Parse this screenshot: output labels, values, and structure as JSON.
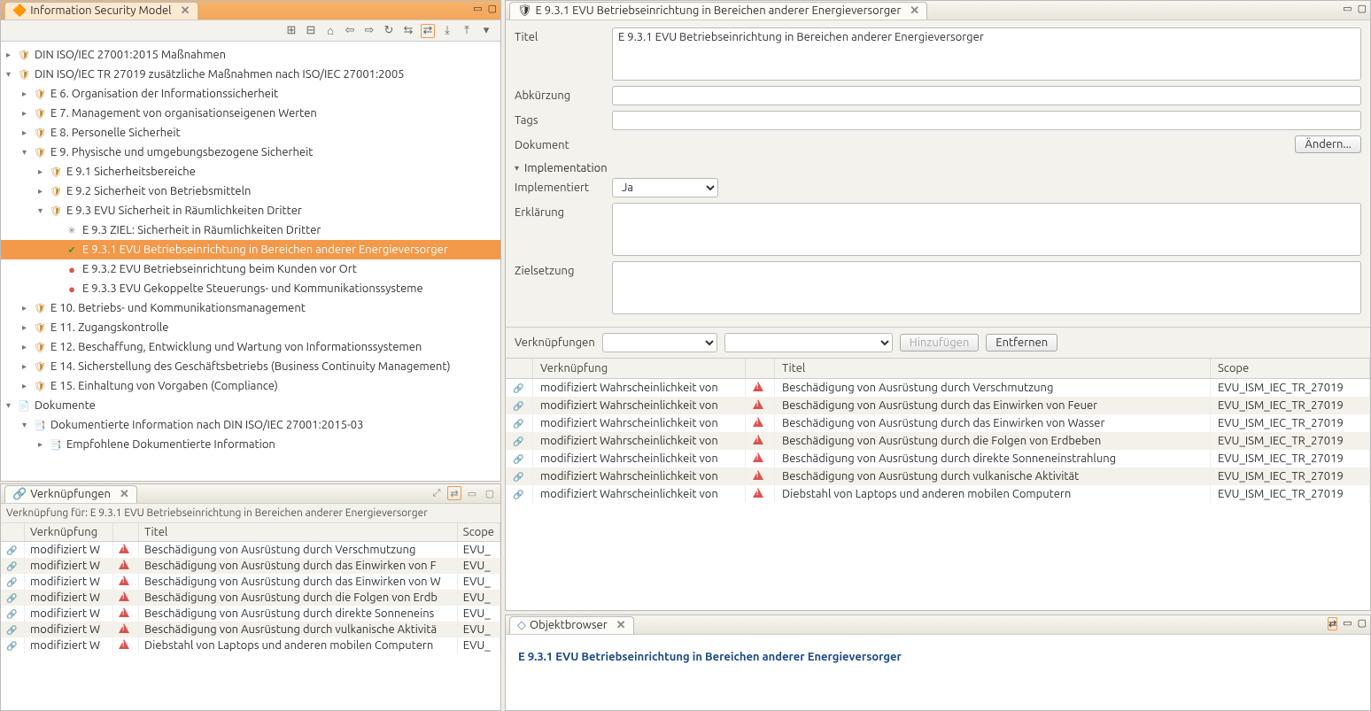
{
  "accent": "#f2994a",
  "left_pane": {
    "title": "Information Security Model",
    "toolbar_icons": [
      "expand",
      "collapse",
      "home",
      "back",
      "fwd",
      "refresh",
      "link-sel",
      "link-all",
      "import",
      "export",
      "filter"
    ],
    "tree": [
      {
        "d": 0,
        "tw": "▸",
        "ic": "shield",
        "label": "DIN ISO/IEC 27001:2015 Maßnahmen"
      },
      {
        "d": 0,
        "tw": "▾",
        "ic": "shield",
        "label": "DIN ISO/IEC TR 27019 zusätzliche Maßnahmen nach ISO/IEC 27001:2005"
      },
      {
        "d": 1,
        "tw": "▸",
        "ic": "shield",
        "label": "E 6. Organisation der Informationssicherheit"
      },
      {
        "d": 1,
        "tw": "▸",
        "ic": "shield",
        "label": "E 7. Management von organisationseigenen Werten"
      },
      {
        "d": 1,
        "tw": "▸",
        "ic": "shield",
        "label": "E 8. Personelle Sicherheit"
      },
      {
        "d": 1,
        "tw": "▾",
        "ic": "shield",
        "label": "E 9. Physische und umgebungsbezogene Sicherheit"
      },
      {
        "d": 2,
        "tw": "▸",
        "ic": "shield",
        "label": "E 9.1 Sicherheitsbereiche"
      },
      {
        "d": 2,
        "tw": "▸",
        "ic": "shield",
        "label": "E 9.2 Sicherheit von Betriebsmitteln"
      },
      {
        "d": 2,
        "tw": "▾",
        "ic": "shield",
        "label": "E 9.3 EVU Sicherheit in Räumlichkeiten Dritter"
      },
      {
        "d": 3,
        "tw": "",
        "ic": "target",
        "label": "E 9.3 ZIEL: Sicherheit in Räumlichkeiten Dritter"
      },
      {
        "d": 3,
        "tw": "",
        "ic": "ok",
        "label": "E 9.3.1 EVU Betriebseinrichtung in Bereichen anderer Energieversorger",
        "sel": true
      },
      {
        "d": 3,
        "tw": "",
        "ic": "warn",
        "label": "E 9.3.2 EVU Betriebseinrichtung beim Kunden vor Ort"
      },
      {
        "d": 3,
        "tw": "",
        "ic": "warn",
        "label": "E 9.3.3 EVU Gekoppelte Steuerungs- und Kommunikationssysteme"
      },
      {
        "d": 1,
        "tw": "▸",
        "ic": "shield",
        "label": "E 10. Betriebs- und Kommunikationsmanagement"
      },
      {
        "d": 1,
        "tw": "▸",
        "ic": "shield",
        "label": "E 11. Zugangskontrolle"
      },
      {
        "d": 1,
        "tw": "▸",
        "ic": "shield",
        "label": "E 12. Beschaffung, Entwicklung und Wartung von Informationssystemen"
      },
      {
        "d": 1,
        "tw": "▸",
        "ic": "shield",
        "label": "E 14. Sicherstellung des Geschäftsbetriebs (Business Continuity Management)"
      },
      {
        "d": 1,
        "tw": "▸",
        "ic": "shield",
        "label": "E 15. Einhaltung von Vorgaben (Compliance)"
      },
      {
        "d": 0,
        "tw": "▾",
        "ic": "folder",
        "label": "Dokumente"
      },
      {
        "d": 1,
        "tw": "▾",
        "ic": "doc",
        "label": "Dokumentierte Information nach DIN ISO/IEC 27001:2015-03"
      },
      {
        "d": 2,
        "tw": "▸",
        "ic": "doc",
        "label": "Empfohlene Dokumentierte Information"
      }
    ]
  },
  "links_small": {
    "title": "Verknüpfungen",
    "sub_label": "Verknüpfung für: E 9.3.1 EVU Betriebseinrichtung in Bereichen anderer Energieversorger",
    "columns": [
      "Verknüpfung",
      "",
      "Titel",
      "Scope"
    ],
    "rows": [
      {
        "v": "modifiziert W",
        "t": "Beschädigung von Ausrüstung durch Verschmutzung",
        "s": "EVU_"
      },
      {
        "v": "modifiziert W",
        "t": "Beschädigung von Ausrüstung durch das Einwirken von F",
        "s": "EVU_"
      },
      {
        "v": "modifiziert W",
        "t": "Beschädigung von Ausrüstung durch das Einwirken von W",
        "s": "EVU_"
      },
      {
        "v": "modifiziert W",
        "t": "Beschädigung von Ausrüstung durch die Folgen von Erdb",
        "s": "EVU_"
      },
      {
        "v": "modifiziert W",
        "t": "Beschädigung von Ausrüstung durch direkte Sonneneins",
        "s": "EVU_"
      },
      {
        "v": "modifiziert W",
        "t": "Beschädigung von Ausrüstung durch vulkanische Aktivitä",
        "s": "EVU_"
      },
      {
        "v": "modifiziert W",
        "t": "Diebstahl von Laptops und anderen mobilen Computern",
        "s": "EVU_"
      }
    ]
  },
  "detail": {
    "tab_title": "E 9.3.1 EVU Betriebseinrichtung in Bereichen anderer Energieversorger",
    "fields": {
      "titel_label": "Titel",
      "titel_value": "E 9.3.1 EVU Betriebseinrichtung in Bereichen anderer Energieversorger",
      "abk_label": "Abkürzung",
      "abk_value": "",
      "tags_label": "Tags",
      "tags_value": "",
      "dokument_label": "Dokument",
      "dokument_btn": "Ändern...",
      "impl_section": "Implementation",
      "implemented_label": "Implementiert",
      "implemented_value": "Ja",
      "erkl_label": "Erklärung",
      "erkl_value": "",
      "ziel_label": "Zielsetzung",
      "ziel_value": ""
    },
    "links_bar": {
      "label": "Verknüpfungen",
      "add_btn": "Hinzufügen",
      "remove_btn": "Entfernen"
    },
    "link_table": {
      "columns": [
        "Verknüpfung",
        "Titel",
        "Scope"
      ],
      "rows": [
        {
          "v": "modifiziert Wahrscheinlichkeit von",
          "t": "Beschädigung von Ausrüstung durch Verschmutzung",
          "s": "EVU_ISM_IEC_TR_27019"
        },
        {
          "v": "modifiziert Wahrscheinlichkeit von",
          "t": "Beschädigung von Ausrüstung durch das Einwirken von Feuer",
          "s": "EVU_ISM_IEC_TR_27019"
        },
        {
          "v": "modifiziert Wahrscheinlichkeit von",
          "t": "Beschädigung von Ausrüstung durch das Einwirken von Wasser",
          "s": "EVU_ISM_IEC_TR_27019"
        },
        {
          "v": "modifiziert Wahrscheinlichkeit von",
          "t": "Beschädigung von Ausrüstung durch die Folgen von Erdbeben",
          "s": "EVU_ISM_IEC_TR_27019"
        },
        {
          "v": "modifiziert Wahrscheinlichkeit von",
          "t": "Beschädigung von Ausrüstung durch direkte Sonneneinstrahlung",
          "s": "EVU_ISM_IEC_TR_27019"
        },
        {
          "v": "modifiziert Wahrscheinlichkeit von",
          "t": "Beschädigung von Ausrüstung durch vulkanische Aktivität",
          "s": "EVU_ISM_IEC_TR_27019"
        },
        {
          "v": "modifiziert Wahrscheinlichkeit von",
          "t": "Diebstahl von Laptops und anderen mobilen Computern",
          "s": "EVU_ISM_IEC_TR_27019"
        }
      ]
    }
  },
  "obj_browser": {
    "title": "Objektbrowser",
    "content_link": "E 9.3.1 EVU Betriebseinrichtung in Bereichen anderer Energieversorger"
  }
}
